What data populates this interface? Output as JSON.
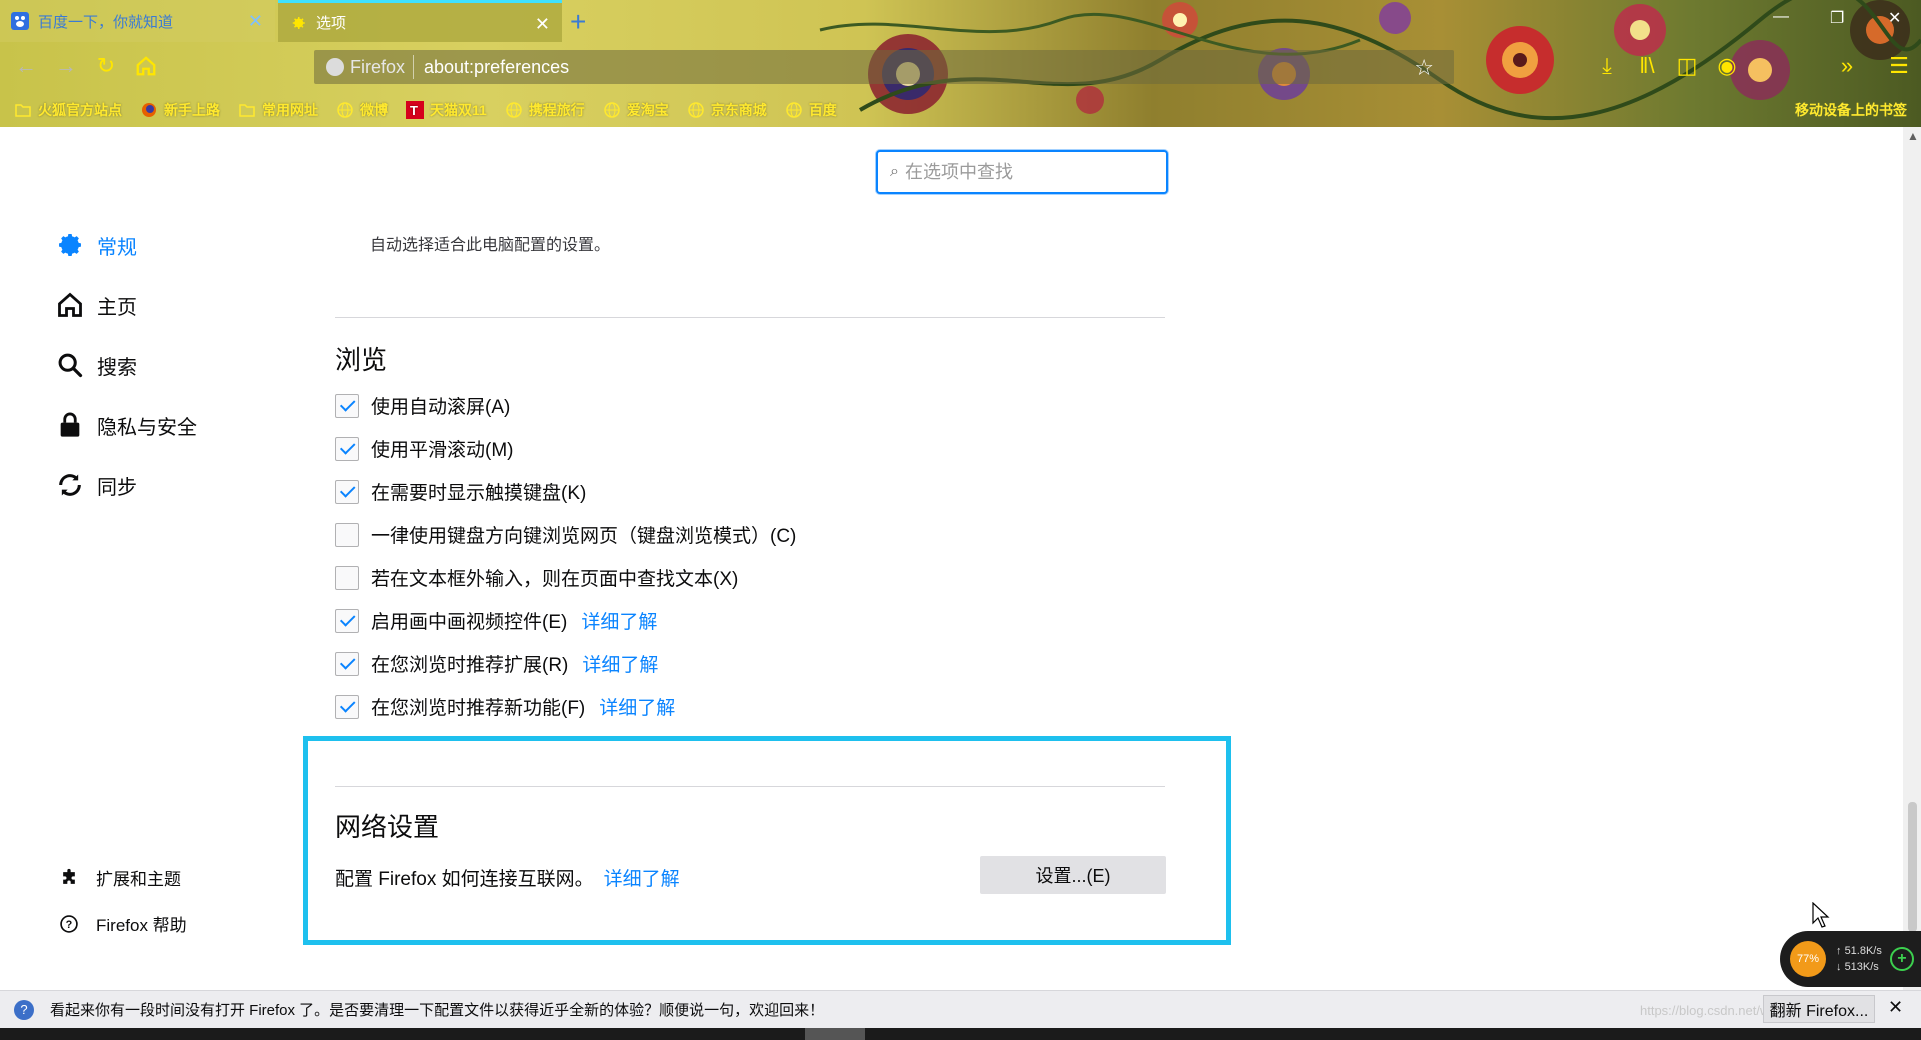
{
  "browser": {
    "tabs": [
      {
        "title": "百度一下，你就知道",
        "icon": "baidu-paw-icon",
        "active": false
      },
      {
        "title": "选项",
        "icon": "gear-icon",
        "active": true
      }
    ],
    "identity_label": "Firefox",
    "url": "about:preferences",
    "bookmarks": [
      {
        "label": "火狐官方站点",
        "icon": "folder-icon"
      },
      {
        "label": "新手上路",
        "icon": "firefox-icon"
      },
      {
        "label": "常用网址",
        "icon": "folder-icon"
      },
      {
        "label": "微博",
        "icon": "globe-icon"
      },
      {
        "label": "天猫双11",
        "icon": "tmall-icon"
      },
      {
        "label": "携程旅行",
        "icon": "globe-icon"
      },
      {
        "label": "爱淘宝",
        "icon": "globe-icon"
      },
      {
        "label": "京东商城",
        "icon": "globe-icon"
      },
      {
        "label": "百度",
        "icon": "globe-icon"
      }
    ],
    "mobile_bookmarks": "移动设备上的书签",
    "accent_color": "#3fe1ff"
  },
  "search": {
    "placeholder": "在选项中查找"
  },
  "sidebar": {
    "categories": [
      {
        "label": "常规",
        "icon": "gear-icon",
        "selected": true
      },
      {
        "label": "主页",
        "icon": "home-icon",
        "selected": false
      },
      {
        "label": "搜索",
        "icon": "search-icon",
        "selected": false
      },
      {
        "label": "隐私与安全",
        "icon": "lock-icon",
        "selected": false
      },
      {
        "label": "同步",
        "icon": "sync-icon",
        "selected": false
      }
    ],
    "footer": [
      {
        "label": "扩展和主题",
        "icon": "puzzle-icon"
      },
      {
        "label": "Firefox 帮助",
        "icon": "help-icon"
      }
    ]
  },
  "main": {
    "performance_note": "自动选择适合此电脑配置的设置。",
    "browsing": {
      "heading": "浏览",
      "options": [
        {
          "label": "使用自动滚屏(A)",
          "checked": true,
          "learn_more": ""
        },
        {
          "label": "使用平滑滚动(M)",
          "checked": true,
          "learn_more": ""
        },
        {
          "label": "在需要时显示触摸键盘(K)",
          "checked": true,
          "learn_more": ""
        },
        {
          "label": "一律使用键盘方向键浏览网页（键盘浏览模式）(C)",
          "checked": false,
          "learn_more": ""
        },
        {
          "label": "若在文本框外输入，则在页面中查找文本(X)",
          "checked": false,
          "learn_more": ""
        },
        {
          "label": "启用画中画视频控件(E)",
          "checked": true,
          "learn_more": "详细了解"
        },
        {
          "label": "在您浏览时推荐扩展(R)",
          "checked": true,
          "learn_more": "详细了解"
        },
        {
          "label": "在您浏览时推荐新功能(F)",
          "checked": true,
          "learn_more": "详细了解"
        }
      ]
    },
    "network": {
      "heading": "网络设置",
      "description": "配置 Firefox 如何连接互联网。",
      "learn_more": "详细了解",
      "button": "设置...(E)",
      "highlight_color": "#1ec0ee"
    }
  },
  "net_widget": {
    "percent": "77%",
    "up": "51.8K/s",
    "down": "513K/s"
  },
  "notification": {
    "text": "看起来你有一段时间没有打开 Firefox 了。是否要清理一下配置文件以获得近乎全新的体验？顺便说一句，欢迎回来！",
    "button": "翻新 Firefox...",
    "watermark": "https://blog.csdn.net/weixin_43304733"
  }
}
